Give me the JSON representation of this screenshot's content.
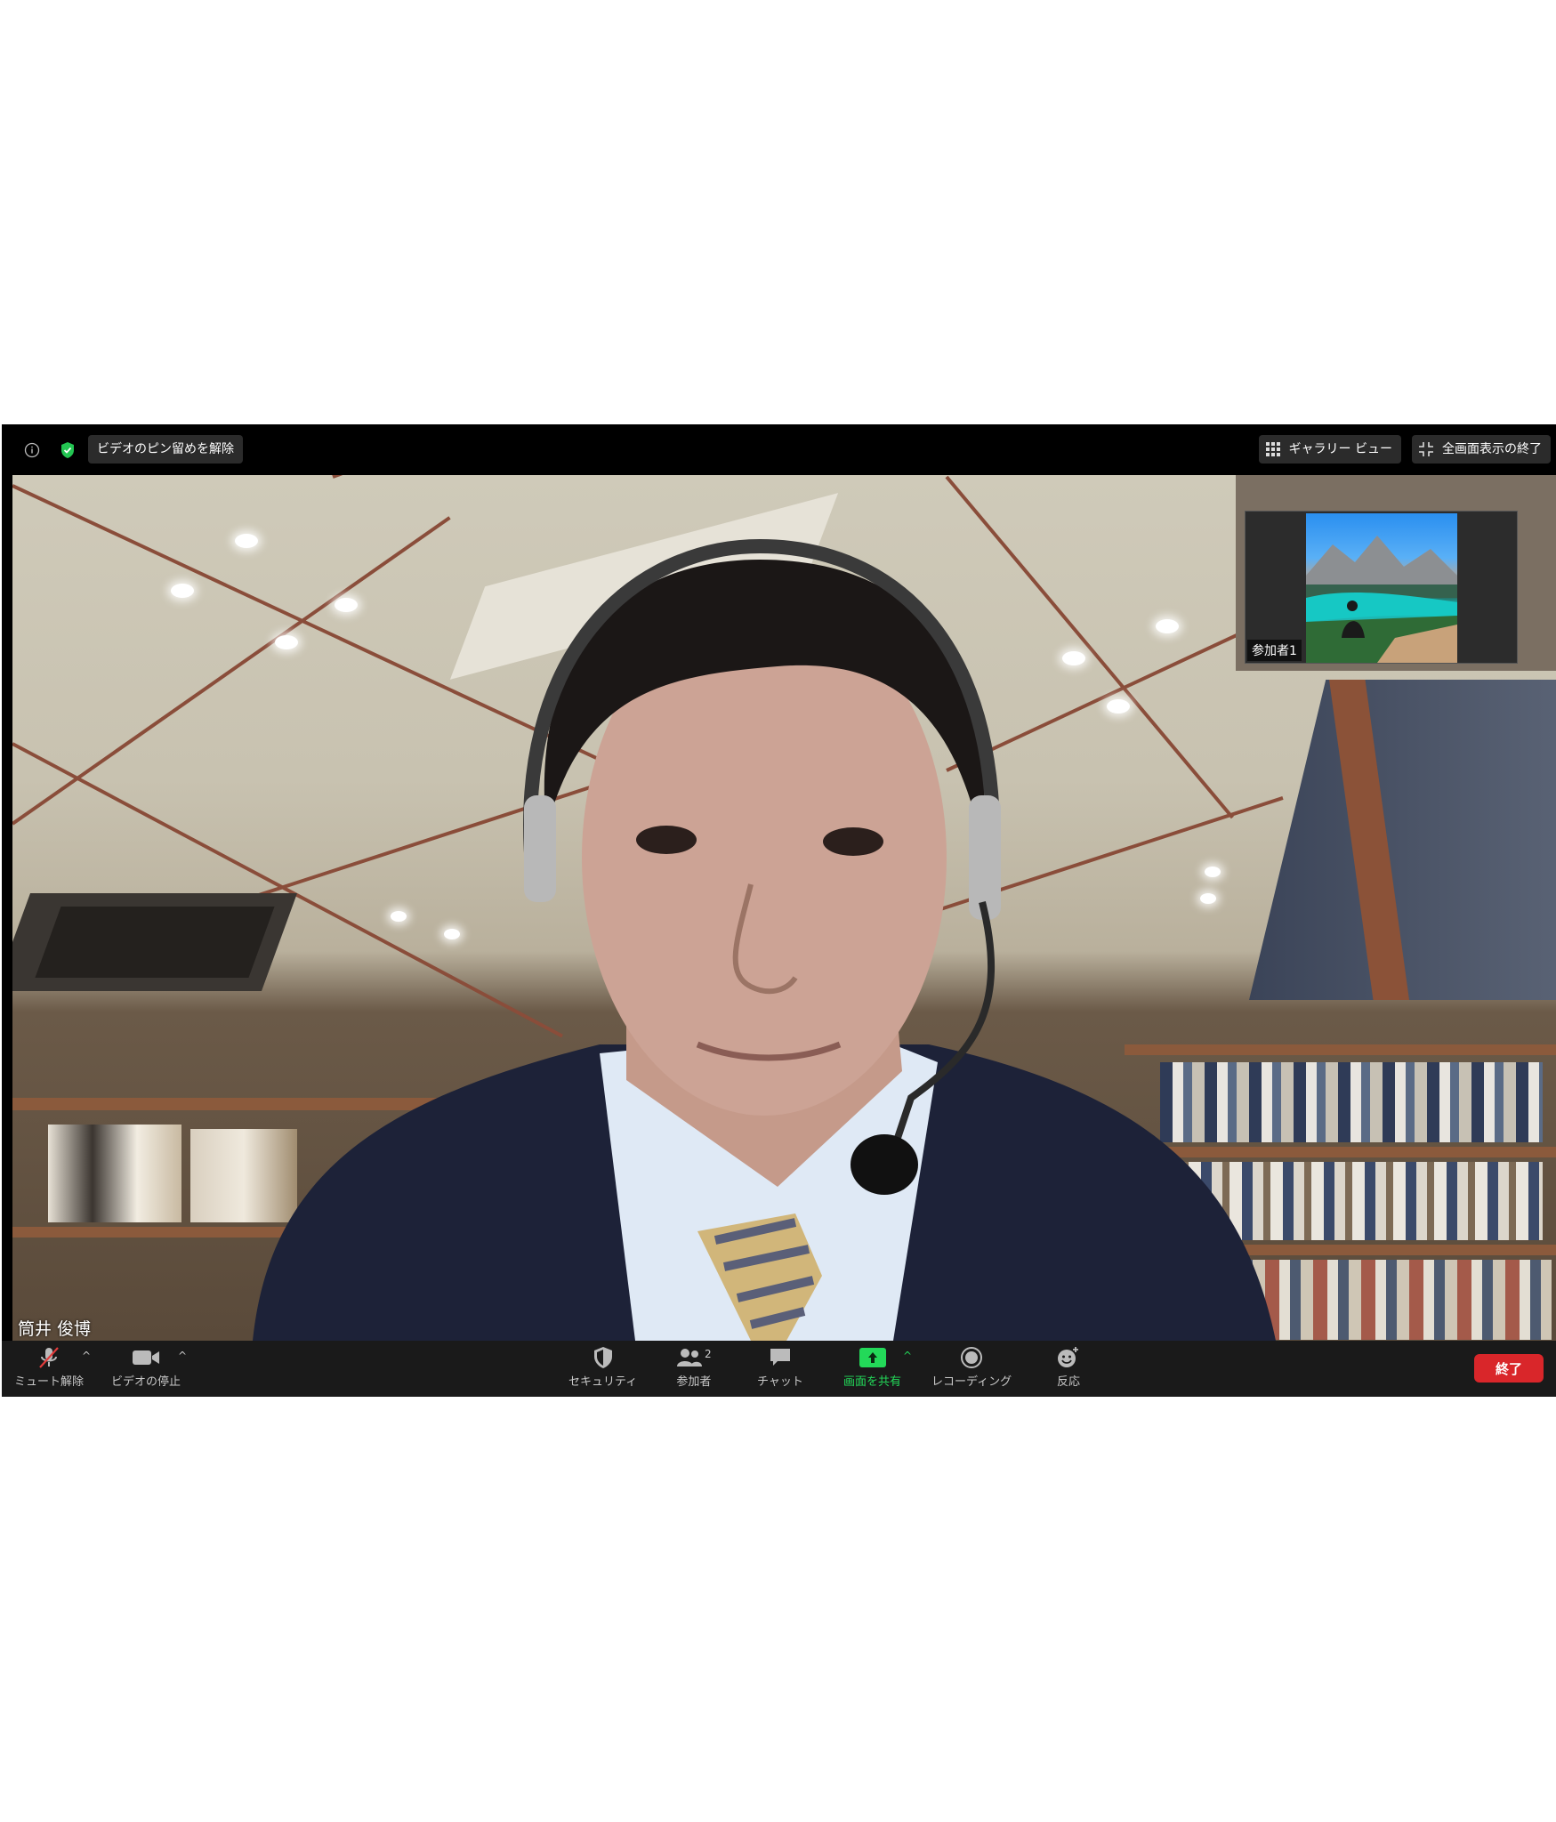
{
  "top_bar": {
    "pin_label": "ビデオのピン留めを解除",
    "gallery_label": "ギャラリー ビュー",
    "exit_fullscreen_label": "全画面表示の終了"
  },
  "main_video": {
    "speaker_name": "筒井 俊博"
  },
  "thumbnail": {
    "participant_label": "参加者1"
  },
  "toolbar": {
    "mute_label": "ミュート解除",
    "video_label": "ビデオの停止",
    "security_label": "セキュリティ",
    "participants_label": "参加者",
    "participants_count": "2",
    "chat_label": "チャット",
    "share_label": "画面を共有",
    "record_label": "レコーディング",
    "reaction_label": "反応",
    "end_label": "終了"
  },
  "colors": {
    "share_green": "#23d959",
    "end_red": "#d9262a",
    "security_green": "#23c552"
  }
}
